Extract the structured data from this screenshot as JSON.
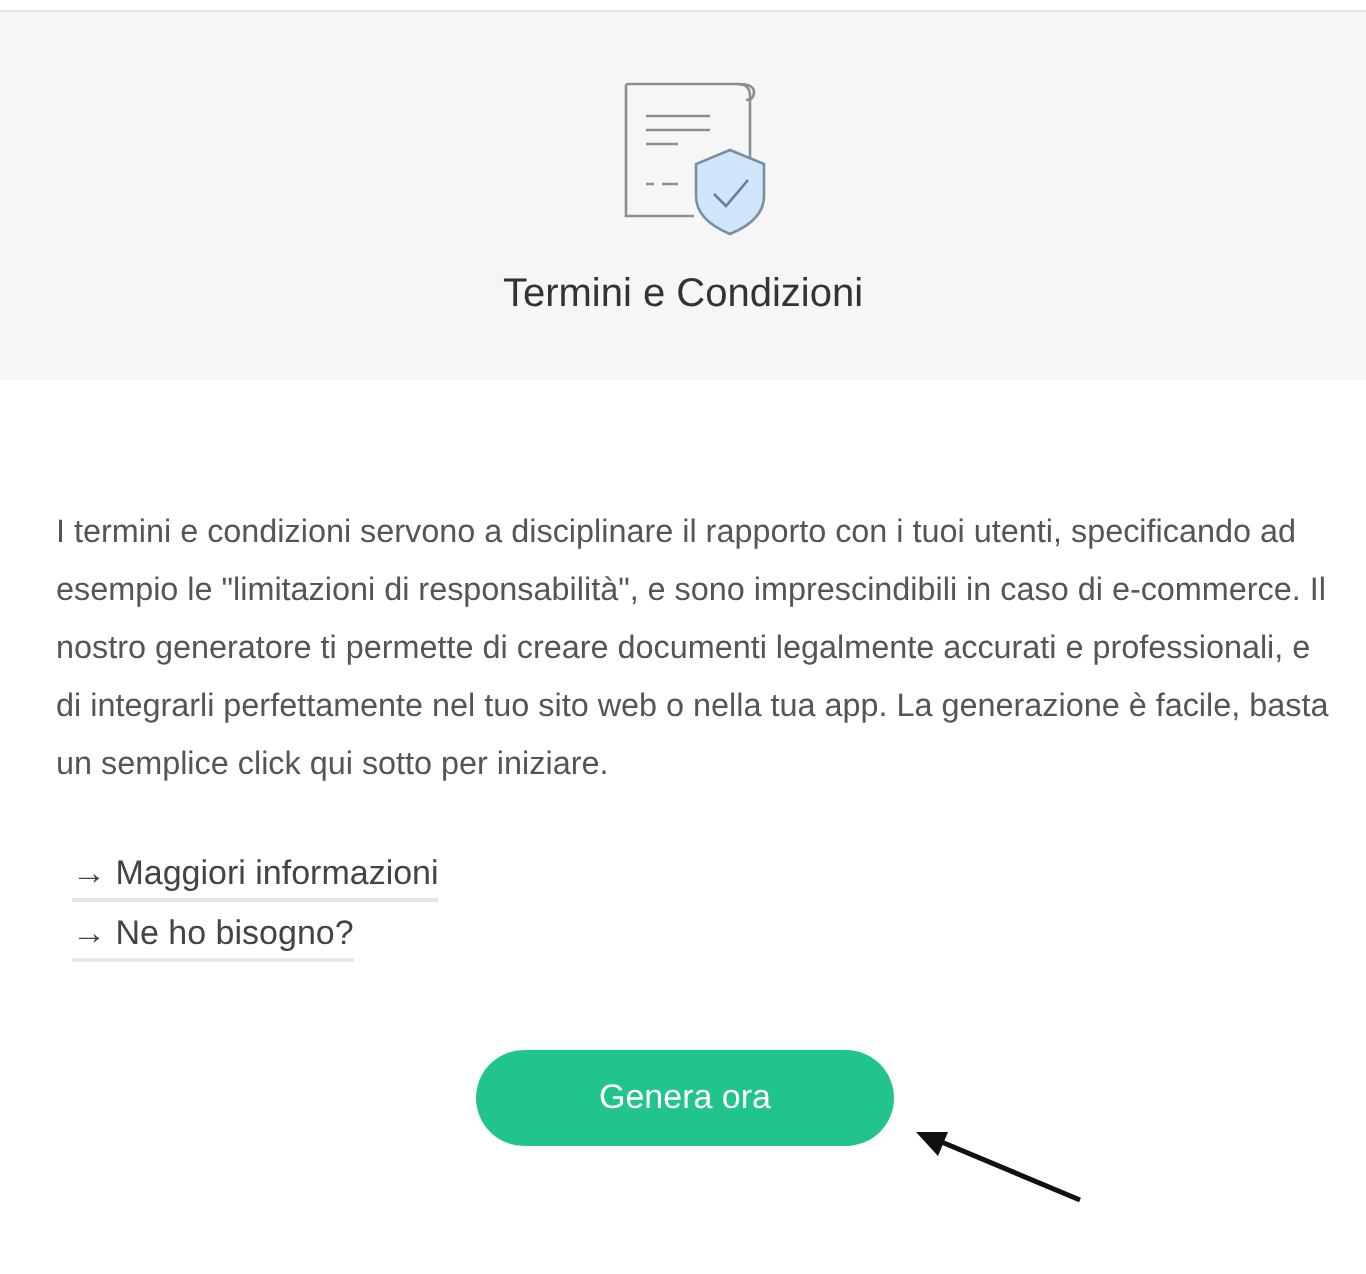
{
  "header": {
    "title": "Termini e Condizioni"
  },
  "description": "I termini e condizioni servono a disciplinare il rapporto con i tuoi utenti, specificando ad esempio le \"limitazioni di responsabilità\", e sono imprescindibili in caso di e-commerce. Il nostro generatore ti permette di creare documenti legalmente accurati e professionali, e di integrarli perfettamente nel tuo sito web o nella tua app. La generazione è facile, basta un semplice click qui sotto per iniziare.",
  "links": [
    "→ Maggiori informazioni",
    "→ Ne ho bisogno?"
  ],
  "button": {
    "label": "Genera ora"
  }
}
